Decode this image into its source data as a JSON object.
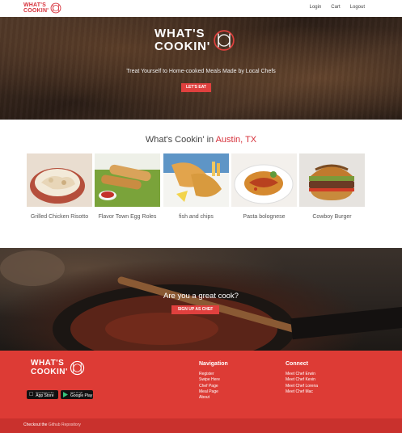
{
  "colors": {
    "brand_red": "#d6303a",
    "footer_red": "#dd3b35",
    "button_red": "#e0403e"
  },
  "nav": {
    "logo_line1": "WHAT'S",
    "logo_line2": "COOKIN'",
    "links": [
      "Login",
      "Cart",
      "Logout"
    ]
  },
  "hero": {
    "logo_line1": "WHAT'S",
    "logo_line2": "COOKIN'",
    "tagline": "Treat Yourself to Home-cooked Meals Made by Local Chefs",
    "cta": "LET'S EAT"
  },
  "featured": {
    "title_prefix": "What's Cookin' in ",
    "city": "Austin, TX",
    "dishes": [
      {
        "name": "Grilled Chicken Risotto"
      },
      {
        "name": "Flavor Town Egg Roles"
      },
      {
        "name": "fish and chips"
      },
      {
        "name": "Pasta bolognese"
      },
      {
        "name": "Cowboy Burger"
      }
    ]
  },
  "cook": {
    "question": "Are you a great cook?",
    "cta": "SIGN UP AS CHEF"
  },
  "footer": {
    "logo_line1": "WHAT'S",
    "logo_line2": "COOKIN'",
    "app_store": {
      "small": "Download on the",
      "big": "App Store"
    },
    "google_play": {
      "small": "GET IT ON",
      "big": "Google Play"
    },
    "navigation": {
      "heading": "Navigation",
      "links": [
        "Register",
        "Swipe Here",
        "Chef Page",
        "Meal Page",
        "About"
      ]
    },
    "connect": {
      "heading": "Connect",
      "links": [
        "Meet Chef Erwin",
        "Meet Chef Kevin",
        "Meet Chef Lorena",
        "Meet Chef Mac"
      ]
    },
    "bottom_prefix": "Checkout the ",
    "bottom_link": "Github Repository"
  }
}
